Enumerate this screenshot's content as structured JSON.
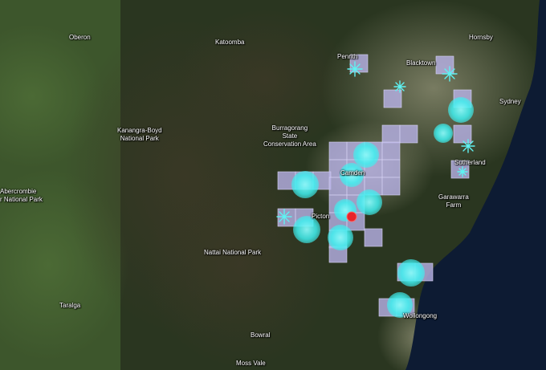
{
  "map": {
    "places": {
      "oberon": "Oberon",
      "katoomba": "Katoomba",
      "penrith": "Penrith",
      "blacktown": "Blacktown",
      "hornsby": "Hornsby",
      "sydney": "Sydney",
      "kanangra_boyd": "Kanangra-Boyd\nNational Park",
      "burragorang": "Burragorang\nState\nConservation Area",
      "camden": "Camden",
      "sutherland": "Sutherland",
      "garawarra": "Garawarra\nFarm",
      "abercrombie": "Abercrombie\nr National Park",
      "picton": "Picton",
      "nattai": "Nattai National Park",
      "taralga": "Taralga",
      "wollongong": "Wollongong",
      "bowral": "Bowral",
      "moss_vale": "Moss Vale"
    },
    "colors": {
      "grid_cell": "#b9b3e8",
      "cyan_circle": "#3ff0f0",
      "epicenter": "#e8242a",
      "ocean": "#0d1b33"
    }
  }
}
